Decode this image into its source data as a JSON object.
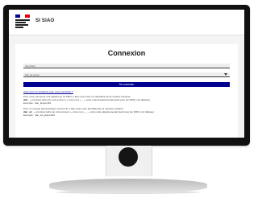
{
  "header": {
    "app_name": "SI SIAO"
  },
  "login": {
    "title": "Connexion",
    "username_placeholder": "Identifiant",
    "password_placeholder": "Mot de passe",
    "submit_label": "Se connecter"
  },
  "help": {
    "problem_link": "Vous avez un problème pour vous connecter ?",
    "line1": "Pour vous connecter à la plateforme SI SIAO, il faut vous créer un identifiant de la manière suivante :",
    "line2_code": "dan_",
    "line2_text": " + première lettre de votre prénom + votre nom + _ + votre code départemental (sauf pour les DOM, voir tableau)",
    "line3": "Exemple : dan_jdupont63",
    "line4": "Pour un compte administrateur service SI, il faut créer votre identifiant de la manière suivante :",
    "line5_code": "dan_sd_",
    "line5_text": " + première lettre de votre prénom + votre nom + _ + votre code départemental (sauf pour les DOM, voir tableau)",
    "line6": "Exemple : dan_sd_jdupont63"
  },
  "colors": {
    "brand_blue": "#000091",
    "marianne_red": "#e1000f"
  }
}
